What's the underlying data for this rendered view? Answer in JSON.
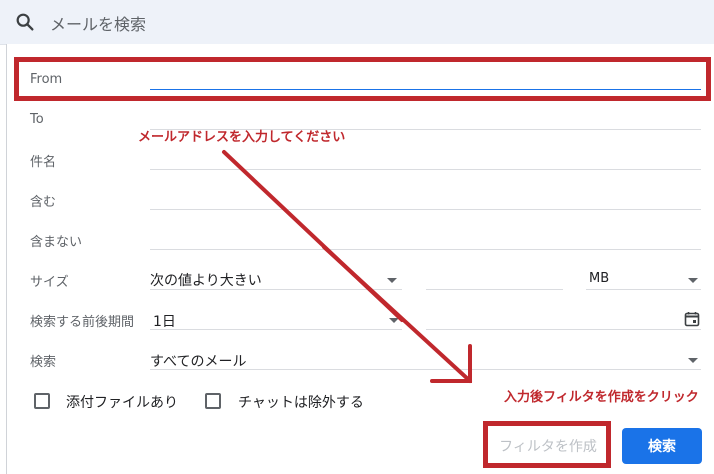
{
  "search": {
    "placeholder": "メールを検索"
  },
  "filter": {
    "from_label": "From",
    "to_label": "To",
    "subject_label": "件名",
    "has_words_label": "含む",
    "doesnt_have_label": "含まない",
    "size": {
      "label": "サイズ",
      "comparator": "次の値より大きい",
      "value": "",
      "unit": "MB"
    },
    "date_within": {
      "label": "検索する前後期間",
      "value": "1日"
    },
    "search_scope": {
      "label": "検索",
      "value": "すべてのメール"
    },
    "has_attachment": {
      "label": "添付ファイルあり",
      "checked": false
    },
    "exclude_chats": {
      "label": "チャットは除外する",
      "checked": false
    },
    "create_filter_label": "フィルタを作成",
    "search_button_label": "検索"
  },
  "annotations": {
    "enter_email": "メールアドレスを入力してください",
    "after_input": "入力後フィルタを作成をクリック",
    "highlight_color": "#c0282d"
  }
}
